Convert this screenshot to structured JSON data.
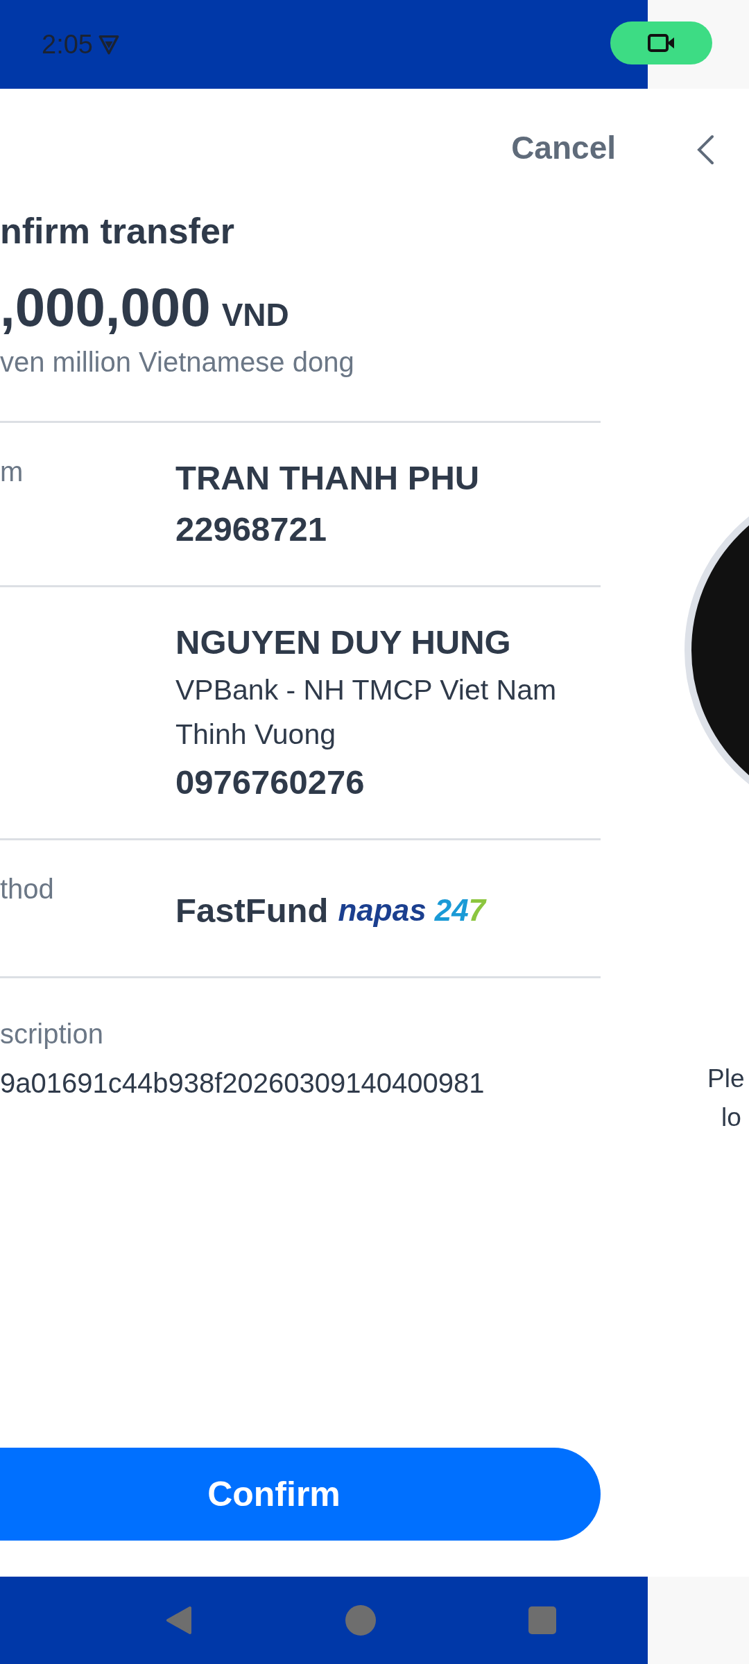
{
  "status_bar": {
    "time": "2:05"
  },
  "sheet": {
    "cancel": "Cancel",
    "title": "nfirm transfer",
    "amount": ",000,000",
    "currency": "VND",
    "amount_words": "ven million Vietnamese dong",
    "rows": [
      {
        "label": "m",
        "lines": [
          {
            "kind": "strong",
            "text": "TRAN THANH PHU"
          },
          {
            "kind": "strong",
            "text": "22968721"
          }
        ]
      },
      {
        "lines": [
          {
            "kind": "strong",
            "text": "NGUYEN DUY HUNG"
          },
          {
            "kind": "plain",
            "text": "VPBank - NH TMCP Viet Nam Thinh Vuong"
          },
          {
            "kind": "strong",
            "text": "0976760276"
          }
        ]
      },
      {
        "label": "thod",
        "lines": [
          {
            "kind": "strong",
            "text": "FastFund"
          }
        ],
        "logo": {
          "word": "napas",
          "number": "247"
        }
      }
    ],
    "description": {
      "label": "scription",
      "value": "9a01691c44b938f20260309140400981"
    },
    "confirm": "Confirm"
  },
  "side_panel": {
    "prompt_lines": [
      "Ple",
      "lo"
    ]
  }
}
